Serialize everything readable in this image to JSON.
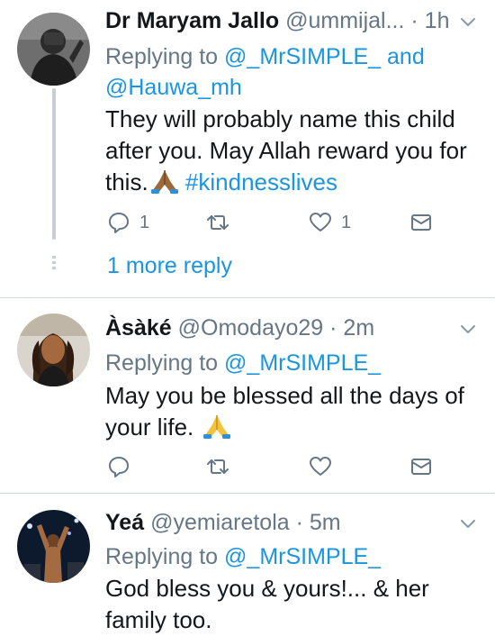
{
  "tweets": [
    {
      "name": "Dr Maryam Jallo",
      "handle": "@ummijal...",
      "time": "· 1h",
      "replying_prefix": "Replying to ",
      "replying_handles": "@_MrSIMPLE_ and",
      "replying_handles_2": "@Hauwa_mh",
      "body_line1": "They will probably name this child",
      "body_line2": "after you. May Allah reward you for",
      "body_line3": "this.",
      "hashtag": "#kindnesslives",
      "reply_count": "1",
      "like_count": "1",
      "more_reply": "1 more reply"
    },
    {
      "name": "Àsàké",
      "handle": "@Omodayo29",
      "time": "· 2m",
      "replying_prefix": "Replying to ",
      "replying_handles": "@_MrSIMPLE_",
      "body_line1": "May you be blessed all the days of",
      "body_line2": "your life."
    },
    {
      "name": "Yeá",
      "handle": "@yemiaretola",
      "time": "· 5m",
      "replying_prefix": "Replying to ",
      "replying_handles": "@_MrSIMPLE_",
      "body_line1": "God bless you & yours!... & her",
      "body_line2": "family too."
    }
  ],
  "icons": {
    "reply": "reply-icon",
    "retweet": "retweet-icon",
    "like": "heart-icon",
    "dm": "envelope-icon",
    "chevron": "chevron-down-icon",
    "pray": "folded-hands-emoji"
  },
  "colors": {
    "link": "#1b95e0",
    "secondary": "#657786",
    "text": "#14171a",
    "thread": "#c4cfd6"
  }
}
